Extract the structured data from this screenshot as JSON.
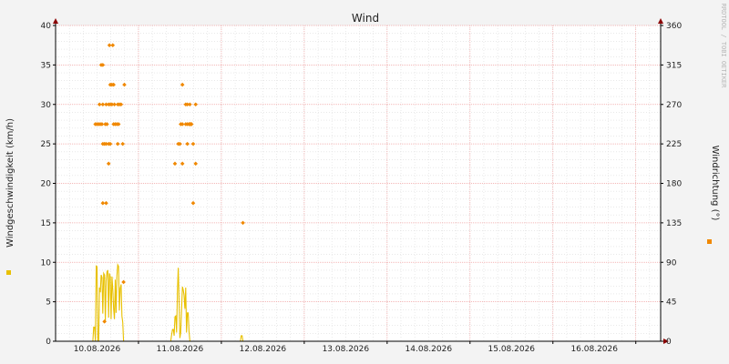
{
  "chart_data": {
    "type": "line",
    "title": "Wind",
    "watermark": "RRDTOOL / TOBI OETIKER",
    "left_axis": {
      "label": "Windgeschwindigkeit (km/h)",
      "ylim": [
        0,
        40
      ],
      "ticks": [
        0,
        5,
        10,
        15,
        20,
        25,
        30,
        35,
        40
      ]
    },
    "right_axis": {
      "label": "Windrichtung (°)",
      "ylim": [
        0,
        360
      ],
      "ticks": [
        0,
        45,
        90,
        135,
        180,
        225,
        270,
        315,
        360
      ]
    },
    "x_axis": {
      "range_days": [
        0,
        7.3
      ],
      "tick_labels": [
        "10.08.2026",
        "11.08.2026",
        "12.08.2026",
        "13.08.2026",
        "14.08.2026",
        "15.08.2026",
        "16.08.2026"
      ],
      "tick_positions_days": [
        0.5,
        1.5,
        2.5,
        3.5,
        4.5,
        5.5,
        6.5
      ]
    },
    "grid": true,
    "colors": {
      "speed": "#e8c000",
      "direction": "#f08800",
      "grid_major": "#f0a0a0",
      "grid_minor": "#dcdcdc",
      "axis": "#000000",
      "arrow": "#8b0000",
      "plot_bg": "#ffffff",
      "page_bg": "#f3f3f3"
    },
    "series": [
      {
        "key": "speed",
        "axis": "left",
        "style": "line",
        "points": [
          [
            0.45,
            0
          ],
          [
            0.46,
            1.8
          ],
          [
            0.47,
            1.8
          ],
          [
            0.48,
            0
          ],
          [
            0.49,
            9.6
          ],
          [
            0.5,
            9.4
          ],
          [
            0.51,
            0
          ],
          [
            0.52,
            0
          ],
          [
            0.53,
            6.8
          ],
          [
            0.54,
            6.2
          ],
          [
            0.55,
            8.4
          ],
          [
            0.56,
            8.1
          ],
          [
            0.57,
            3.5
          ],
          [
            0.58,
            8.6
          ],
          [
            0.59,
            8.4
          ],
          [
            0.6,
            2.5
          ],
          [
            0.61,
            7.7
          ],
          [
            0.62,
            8.8
          ],
          [
            0.63,
            9.0
          ],
          [
            0.64,
            3.0
          ],
          [
            0.65,
            8.6
          ],
          [
            0.66,
            8.2
          ],
          [
            0.67,
            2.8
          ],
          [
            0.68,
            8.2
          ],
          [
            0.69,
            6.5
          ],
          [
            0.7,
            4.1
          ],
          [
            0.71,
            2.8
          ],
          [
            0.72,
            7.8
          ],
          [
            0.73,
            3.6
          ],
          [
            0.74,
            8.3
          ],
          [
            0.75,
            9.7
          ],
          [
            0.76,
            9.5
          ],
          [
            0.77,
            3.9
          ],
          [
            0.78,
            6.7
          ],
          [
            0.79,
            7.2
          ],
          [
            0.8,
            3.2
          ],
          [
            0.81,
            2.4
          ],
          [
            0.82,
            0
          ],
          [
            0.83,
            0
          ],
          [
            1.39,
            0
          ],
          [
            1.4,
            0.8
          ],
          [
            1.41,
            1.5
          ],
          [
            1.42,
            1.5
          ],
          [
            1.43,
            0.7
          ],
          [
            1.44,
            3.1
          ],
          [
            1.45,
            3.2
          ],
          [
            1.46,
            1.1
          ],
          [
            1.47,
            6.2
          ],
          [
            1.48,
            9.3
          ],
          [
            1.49,
            5.2
          ],
          [
            1.5,
            0.4
          ],
          [
            1.51,
            1.1
          ],
          [
            1.52,
            4.1
          ],
          [
            1.53,
            6.9
          ],
          [
            1.54,
            6.5
          ],
          [
            1.55,
            5.8
          ],
          [
            1.56,
            4.1
          ],
          [
            1.57,
            6.8
          ],
          [
            1.58,
            1.1
          ],
          [
            1.59,
            3.6
          ],
          [
            1.6,
            3.6
          ],
          [
            1.61,
            1.3
          ],
          [
            1.62,
            0
          ],
          [
            1.63,
            0
          ],
          [
            2.23,
            0
          ],
          [
            2.24,
            0.7
          ],
          [
            2.25,
            0.7
          ],
          [
            2.26,
            0
          ]
        ]
      },
      {
        "key": "direction",
        "axis": "right",
        "style": "markers",
        "points": [
          [
            0.48,
            247.5
          ],
          [
            0.5,
            247.5
          ],
          [
            0.52,
            247.5
          ],
          [
            0.54,
            247.5
          ],
          [
            0.56,
            247.5
          ],
          [
            0.6,
            247.5
          ],
          [
            0.62,
            247.5
          ],
          [
            0.7,
            247.5
          ],
          [
            0.72,
            247.5
          ],
          [
            0.74,
            247.5
          ],
          [
            0.76,
            247.5
          ],
          [
            0.53,
            270
          ],
          [
            0.57,
            270
          ],
          [
            0.61,
            270
          ],
          [
            0.64,
            270
          ],
          [
            0.66,
            270
          ],
          [
            0.68,
            270
          ],
          [
            0.71,
            270
          ],
          [
            0.75,
            270
          ],
          [
            0.77,
            270
          ],
          [
            0.79,
            270
          ],
          [
            0.55,
            315
          ],
          [
            0.57,
            315
          ],
          [
            0.66,
            292.5
          ],
          [
            0.68,
            292.5
          ],
          [
            0.7,
            292.5
          ],
          [
            0.83,
            292.5
          ],
          [
            0.65,
            337.5
          ],
          [
            0.69,
            337.5
          ],
          [
            0.57,
            225
          ],
          [
            0.59,
            225
          ],
          [
            0.61,
            225
          ],
          [
            0.64,
            225
          ],
          [
            0.66,
            225
          ],
          [
            0.75,
            225
          ],
          [
            0.81,
            225
          ],
          [
            0.64,
            202.5
          ],
          [
            0.57,
            157.5
          ],
          [
            0.61,
            157.5
          ],
          [
            0.59,
            22.5
          ],
          [
            0.82,
            67.5
          ],
          [
            1.44,
            202.5
          ],
          [
            1.53,
            202.5
          ],
          [
            1.69,
            202.5
          ],
          [
            1.48,
            225
          ],
          [
            1.5,
            225
          ],
          [
            1.59,
            225
          ],
          [
            1.66,
            225
          ],
          [
            1.51,
            247.5
          ],
          [
            1.53,
            247.5
          ],
          [
            1.57,
            247.5
          ],
          [
            1.59,
            247.5
          ],
          [
            1.61,
            247.5
          ],
          [
            1.62,
            247.5
          ],
          [
            1.63,
            247.5
          ],
          [
            1.64,
            247.5
          ],
          [
            1.57,
            270
          ],
          [
            1.59,
            270
          ],
          [
            1.62,
            270
          ],
          [
            1.69,
            270
          ],
          [
            1.53,
            292.5
          ],
          [
            1.66,
            157.5
          ],
          [
            2.26,
            135
          ]
        ]
      }
    ]
  }
}
